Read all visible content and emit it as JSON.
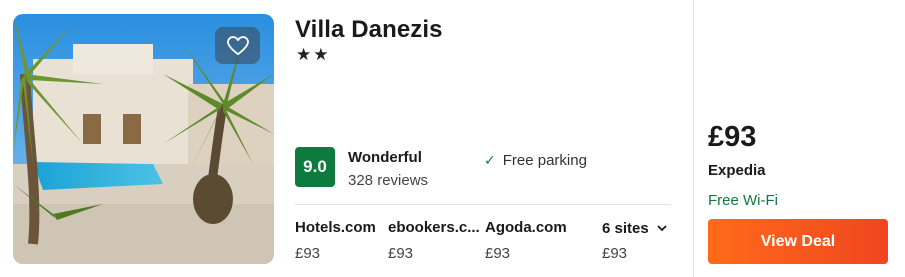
{
  "hotel": {
    "name": "Villa Danezis",
    "stars_text": "★★",
    "star_count": 2,
    "favorite_icon": "heart-outline-icon",
    "rating": {
      "score": "9.0",
      "label": "Wonderful",
      "reviews": "328 reviews",
      "badge_color": "#0f7a3e"
    },
    "amenity": {
      "icon": "check-icon",
      "label": "Free parking"
    }
  },
  "sites": [
    {
      "name": "Hotels.com",
      "price": "£93"
    },
    {
      "name": "ebookers.c...",
      "price": "£93"
    },
    {
      "name": "Agoda.com",
      "price": "£93"
    },
    {
      "name": "6 sites",
      "price": "£93"
    }
  ],
  "more_sites_icon": "chevron-down-icon",
  "deal": {
    "price": "£93",
    "provider": "Expedia",
    "perk": "Free Wi-Fi",
    "perk_color": "#0f7a3e",
    "button_label": "View Deal",
    "button_color": "#f25a1d"
  }
}
